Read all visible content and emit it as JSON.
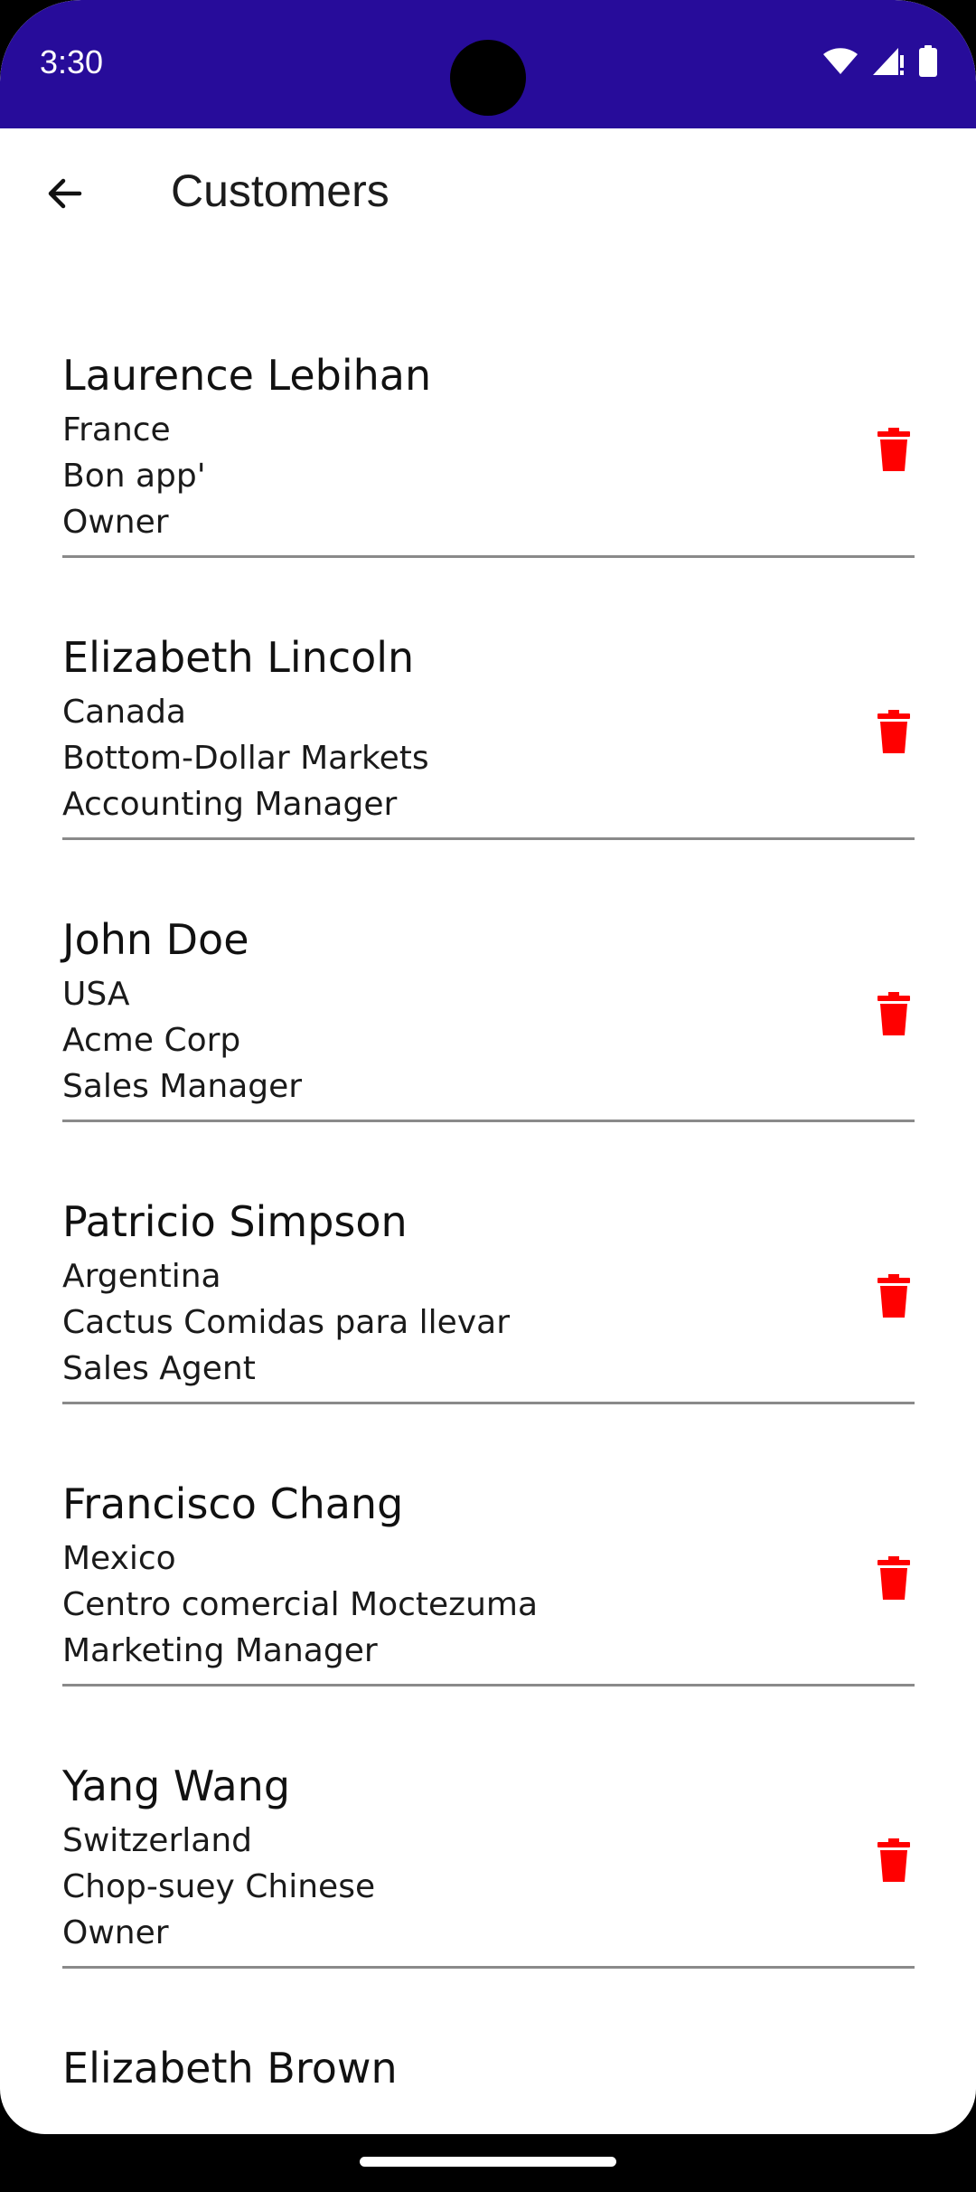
{
  "status_bar": {
    "time": "3:30",
    "background": "#270C9A",
    "icons": [
      "wifi-icon",
      "cell-signal-icon",
      "battery-icon"
    ]
  },
  "app_bar": {
    "title": "Customers",
    "back_icon": "arrow-left-icon"
  },
  "accent": {
    "delete_color": "#FF0000"
  },
  "customers": [
    {
      "name": "Laurence Lebihan",
      "country": "France",
      "company": "Bon app'",
      "role": "Owner"
    },
    {
      "name": "Elizabeth Lincoln",
      "country": "Canada",
      "company": "Bottom-Dollar Markets",
      "role": "Accounting Manager"
    },
    {
      "name": "John Doe",
      "country": "USA",
      "company": "Acme Corp",
      "role": "Sales Manager"
    },
    {
      "name": "Patricio Simpson",
      "country": "Argentina",
      "company": "Cactus Comidas para llevar",
      "role": "Sales Agent"
    },
    {
      "name": "Francisco Chang",
      "country": "Mexico",
      "company": "Centro comercial Moctezuma",
      "role": "Marketing Manager"
    },
    {
      "name": "Yang Wang",
      "country": "Switzerland",
      "company": "Chop-suey Chinese",
      "role": "Owner"
    },
    {
      "name": "Elizabeth Brown"
    }
  ]
}
